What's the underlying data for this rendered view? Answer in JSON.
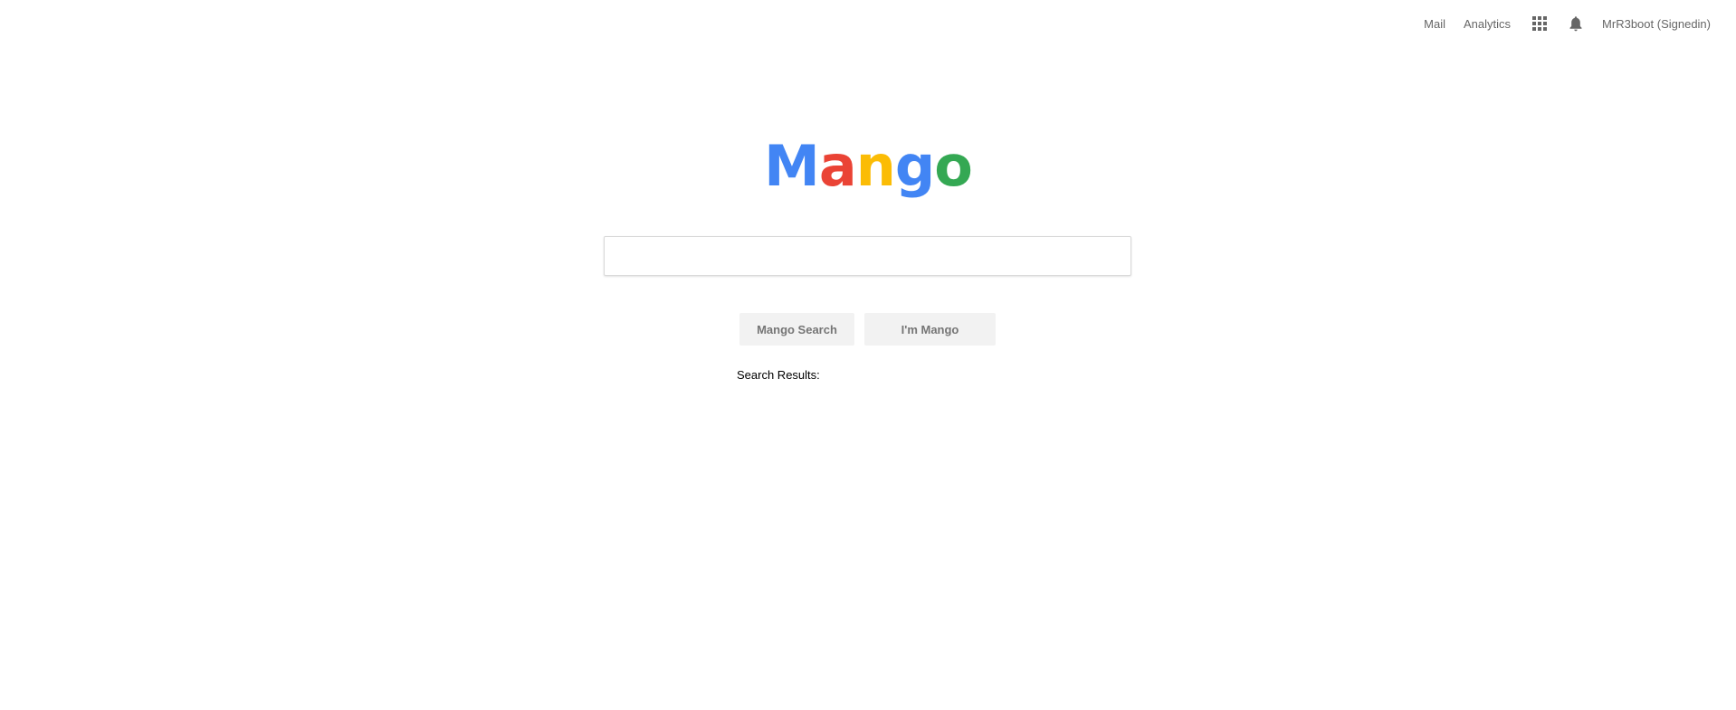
{
  "header": {
    "mail_label": "Mail",
    "analytics_label": "Analytics",
    "apps_icon": "apps-grid-icon",
    "notifications_icon": "bell-icon",
    "user_label": "MrR3boot (Signedin)"
  },
  "logo": {
    "letters": [
      "M",
      "a",
      "n",
      "g",
      "o"
    ],
    "colors": [
      "#4285f4",
      "#ea4335",
      "#fbbc05",
      "#4285f4",
      "#34a853"
    ]
  },
  "search": {
    "value": "",
    "placeholder": ""
  },
  "buttons": {
    "search_label": "Mango Search",
    "lucky_label": "I'm Mango"
  },
  "results": {
    "label": "Search Results:"
  }
}
